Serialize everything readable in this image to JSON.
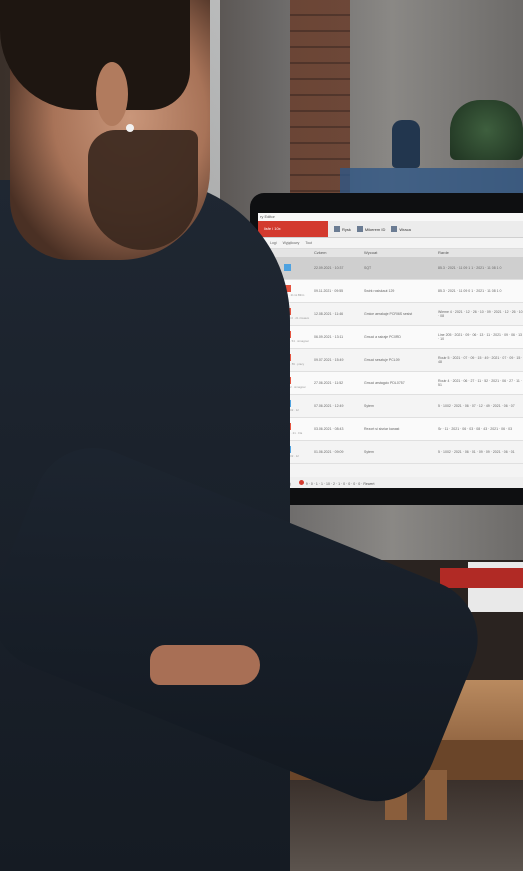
{
  "app": {
    "window_title": "ry Editor",
    "brand_label": "lisfe i 10x",
    "toolbar": [
      {
        "label": "Rysk",
        "icon": "document-icon"
      },
      {
        "label": "Mikerem ID",
        "icon": "checkbox-icon"
      },
      {
        "label": "Wraca",
        "icon": "calendar-icon"
      }
    ],
    "filters": [
      "Logi",
      "Wyjątkowy",
      "Tout"
    ],
    "columns": [
      "",
      "Czkem",
      "Wycoat",
      "Rarde"
    ],
    "rows": [
      {
        "icon": "blue",
        "tag": "",
        "date": "22.09.2021 · 10:37",
        "desc": "SQT",
        "detail": "85.3 · 2021 · 11 09 1 1 · 2021 · 11 08 1 0",
        "selected": true
      },
      {
        "icon": "red",
        "tag": "Kunstanfr · 0.0 · 21 ist Bilrin",
        "date": "09.11.2021 · 09:55",
        "desc": "Swirk rosiskaut 129",
        "detail": "85.3 · 2021 · 11 09 0 1 · 2021 · 11 08 1 0"
      },
      {
        "icon": "red",
        "tag": "Konfiguration · 11 · 0.0 · 21 rimaiem",
        "date": "12.08.2021 · 11:46",
        "desc": "Gmice aerakaje PCRI6S sesist",
        "detail": "Wieme 4 · 2021 · 12 · 26 · 10 · 09 · 2021 · 12 · 26 · 10 · 08"
      },
      {
        "icon": "red",
        "tag": "Kunstanfr · 2.4 · 14 · 54 · simagnar",
        "date": "06.09.2021 · 13:11",
        "desc": "Gmuci a ssiraje PC0RD",
        "detail": "Line 205 · 2021 · 09 · 06 · 13 · 11 · 2021 · 09 · 06 · 13 · 10"
      },
      {
        "icon": "red",
        "tag": "Zespol · 11 · 06 · 59 · pracy",
        "date": "09.07.2021 · 15:49",
        "desc": "Gmuci sesztuje PCL09",
        "detail": "Routr 5 · 2021 · 07 · 09 · 15 · 49 · 2021 · 07 · 09 · 15 · 48"
      },
      {
        "icon": "red",
        "tag": "Konto · 0.0 · 8 · 02 · simagnar",
        "date": "27.06.2021 · 11:52",
        "desc": "Gmuci arstagcic PDL0757",
        "detail": "Routr 4 · 2021 · 06 · 27 · 11 · 52 · 2021 · 06 · 27 · 11 · 51"
      },
      {
        "icon": "blue",
        "tag": "SQL 2021 · 02 · 12",
        "date": "07.06.2021 · 12:49",
        "desc": "Sytem",
        "detail": "5 · 1002 · 2021 · 06 · 07 · 12 · 49 · 2021 · 06 · 07"
      },
      {
        "icon": "red",
        "tag": "Kunstanfr · 5.0 · 21 · Fla",
        "date": "03.06.2021 · 08:43",
        "desc": "Rezort si sisriar kanast",
        "detail": "Sr · 11 · 2021 · 06 · 03 · 08 · 43 · 2021 · 06 · 03"
      },
      {
        "icon": "blue",
        "tag": "SQL 2021 · 02 · 12",
        "date": "01.06.2021 · 09:09",
        "desc": "Sytem",
        "detail": "5 · 1002 · 2021 · 06 · 01 · 09 · 09 · 2021 · 06 · 01"
      }
    ],
    "status": [
      {
        "label": "Ulozenie 1 (0)",
        "color": "#3a7bd5"
      },
      {
        "label": "9 · 0 · 1 · 1 · 10 · 2 · 1 · 0 · 0 · 0 · 0 · Rewert",
        "color": "#d33a2e"
      }
    ]
  }
}
